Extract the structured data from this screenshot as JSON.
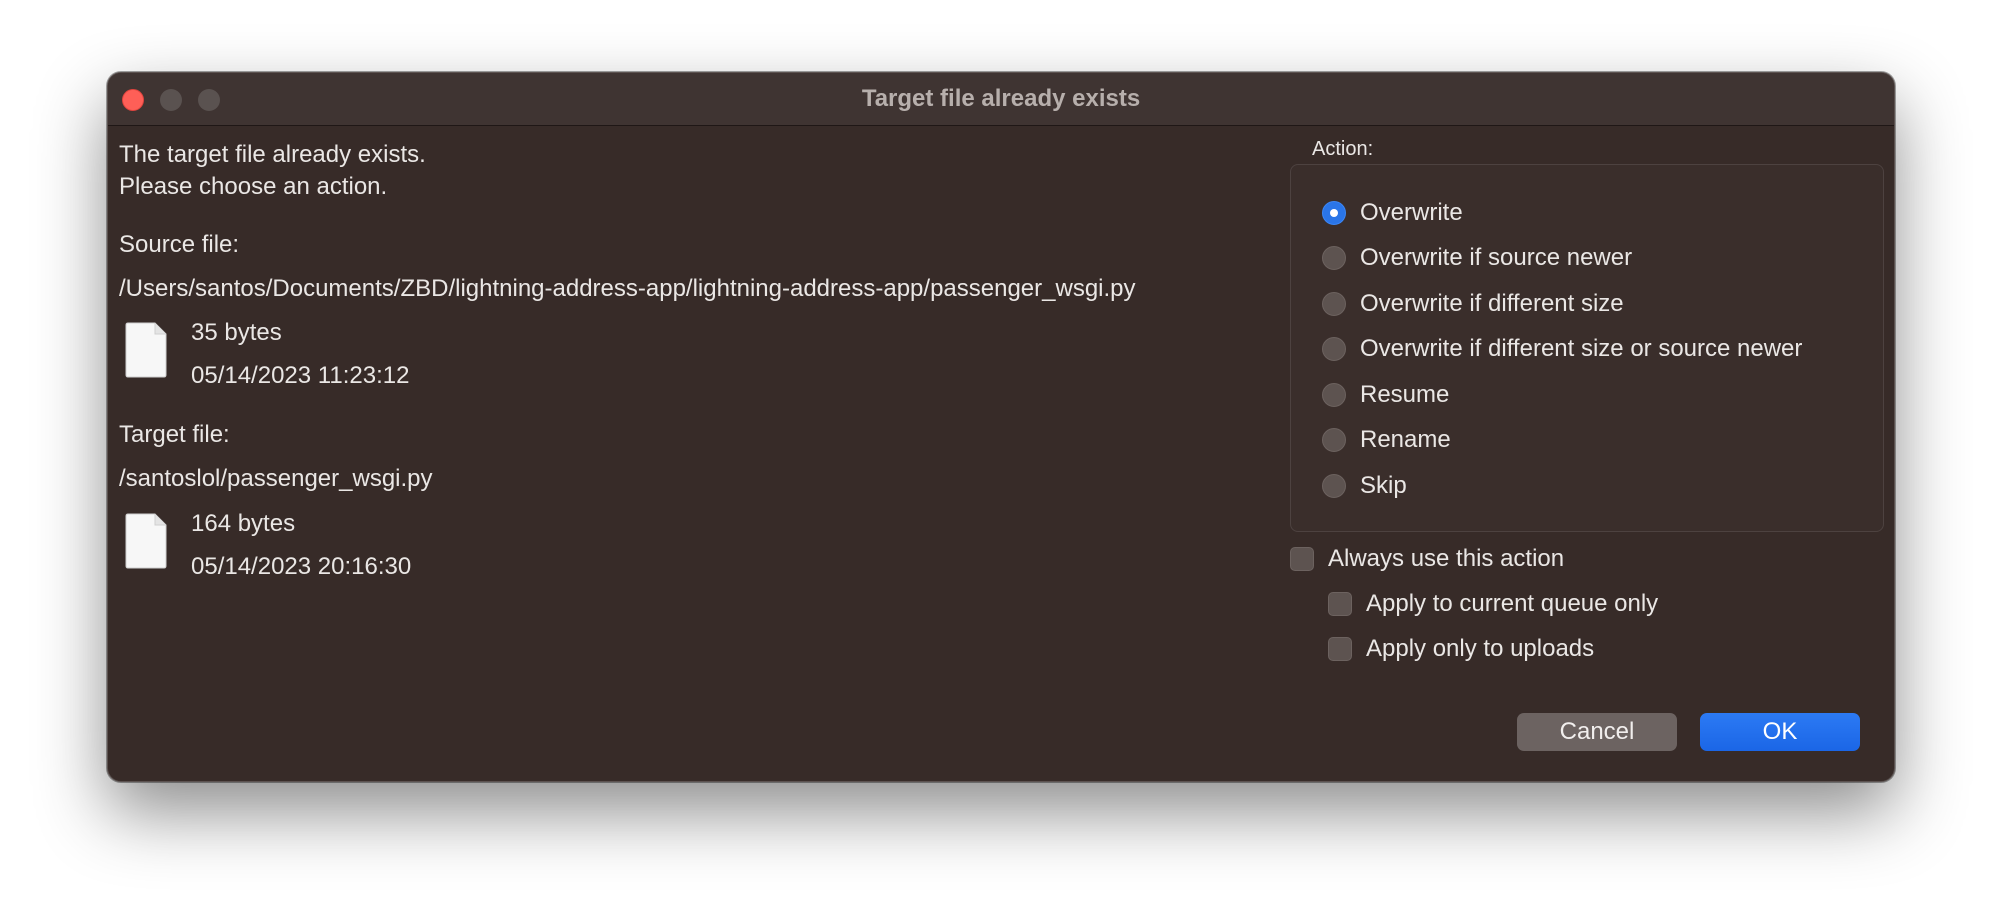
{
  "window": {
    "title": "Target file already exists"
  },
  "message": {
    "line1": "The target file already exists.",
    "line2": "Please choose an action."
  },
  "source": {
    "heading": "Source file:",
    "path": "/Users/santos/Documents/ZBD/lightning-address-app/lightning-address-app/passenger_wsgi.py",
    "size": "35 bytes",
    "modified": "05/14/2023 11:23:12",
    "icon": "document-icon"
  },
  "target": {
    "heading": "Target file:",
    "path": "/santoslol/passenger_wsgi.py",
    "size": "164 bytes",
    "modified": "05/14/2023 20:16:30",
    "icon": "document-icon"
  },
  "action": {
    "heading": "Action:",
    "selected": "Overwrite",
    "options": [
      "Overwrite",
      "Overwrite if source newer",
      "Overwrite if different size",
      "Overwrite if different size or source newer",
      "Resume",
      "Rename",
      "Skip"
    ]
  },
  "options": {
    "always_use": {
      "label": "Always use this action",
      "checked": false
    },
    "current_queue_only": {
      "label": "Apply to current queue only",
      "checked": false
    },
    "uploads_only": {
      "label": "Apply only to uploads",
      "checked": false
    }
  },
  "buttons": {
    "cancel": "Cancel",
    "ok": "OK"
  },
  "colors": {
    "window_bg": "#372b28",
    "accent": "#1f6ff0",
    "close_button": "#fe5f57"
  }
}
